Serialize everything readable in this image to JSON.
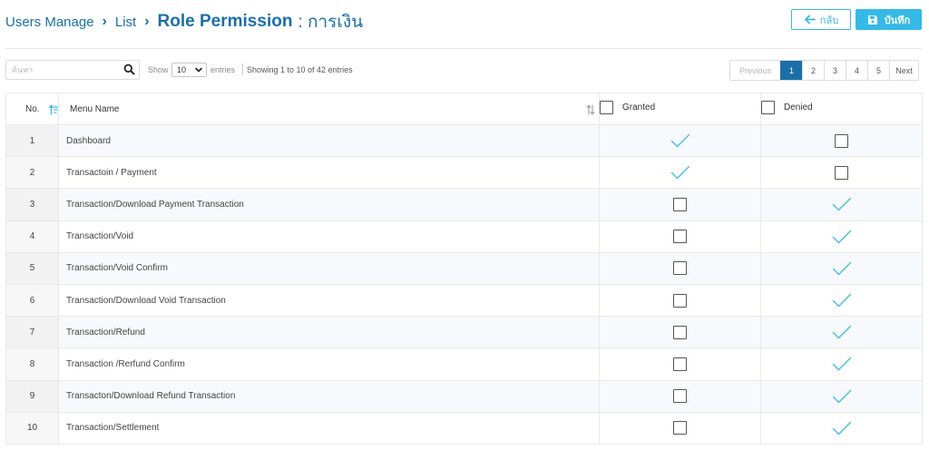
{
  "breadcrumb": {
    "users_manage": "Users Manage",
    "list": "List",
    "title": "Role Permission",
    "title_suffix": ": การเงิน"
  },
  "buttons": {
    "back_label": "กลับ",
    "save_label": "บันทึก"
  },
  "toolbar": {
    "search_placeholder": "ค้นหา",
    "show_label": "Show",
    "page_length": "10",
    "entries_label": "entries",
    "info": "Showing 1 to 10 of 42 entries"
  },
  "pagination": {
    "previous": "Previous",
    "pages": [
      "1",
      "2",
      "3",
      "4",
      "5"
    ],
    "active_page": "1",
    "next": "Next"
  },
  "table": {
    "headers": {
      "no": "No.",
      "menu_name": "Menu Name",
      "granted": "Granted",
      "denied": "Denied"
    },
    "rows": [
      {
        "no": "1",
        "name": "Dashboard",
        "granted": true,
        "denied": false
      },
      {
        "no": "2",
        "name": "Transactoin / Payment",
        "granted": true,
        "denied": false
      },
      {
        "no": "3",
        "name": "Transaction/Download Payment Transaction",
        "granted": false,
        "denied": true
      },
      {
        "no": "4",
        "name": "Transaction/Void",
        "granted": false,
        "denied": true
      },
      {
        "no": "5",
        "name": "Transaction/Void Confirm",
        "granted": false,
        "denied": true
      },
      {
        "no": "6",
        "name": "Transaction/Download Void Transaction",
        "granted": false,
        "denied": true
      },
      {
        "no": "7",
        "name": "Transaction/Refund",
        "granted": false,
        "denied": true
      },
      {
        "no": "8",
        "name": "Transaction /Rerfund Confirm",
        "granted": false,
        "denied": true
      },
      {
        "no": "9",
        "name": "Transacton/Download Refund Transaction",
        "granted": false,
        "denied": true
      },
      {
        "no": "10",
        "name": "Transaction/Settlement",
        "granted": false,
        "denied": true
      }
    ]
  },
  "colors": {
    "primary": "#1b6fa8",
    "accent": "#35b9e6",
    "check": "#3dbde0"
  },
  "icons": {
    "back": "arrow-left-icon",
    "save": "floppy-disk-icon",
    "search": "search-icon",
    "sort_asc": "sort-ascending-icon",
    "sort_both": "sort-both-icon",
    "checked": "check-icon",
    "unchecked": "checkbox-icon"
  }
}
